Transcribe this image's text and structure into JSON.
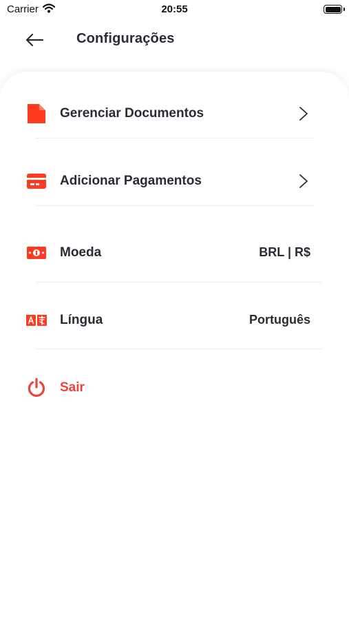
{
  "status_bar": {
    "carrier": "Carrier",
    "time": "20:55"
  },
  "header": {
    "title": "Configurações"
  },
  "menu": {
    "documents": {
      "label": "Gerenciar Documentos",
      "icon": "document-icon"
    },
    "payments": {
      "label": "Adicionar Pagamentos",
      "icon": "credit-card-icon"
    },
    "currency": {
      "label": "Moeda",
      "value": "BRL | R$",
      "icon": "money-icon"
    },
    "language": {
      "label": "Língua",
      "value": "Português",
      "icon": "translate-icon"
    },
    "logout": {
      "label": "Sair",
      "icon": "power-icon"
    }
  },
  "colors": {
    "accent": "#ff3b1f",
    "logout": "#f04238",
    "text": "#2b2b35",
    "divider": "#eeeeee"
  }
}
